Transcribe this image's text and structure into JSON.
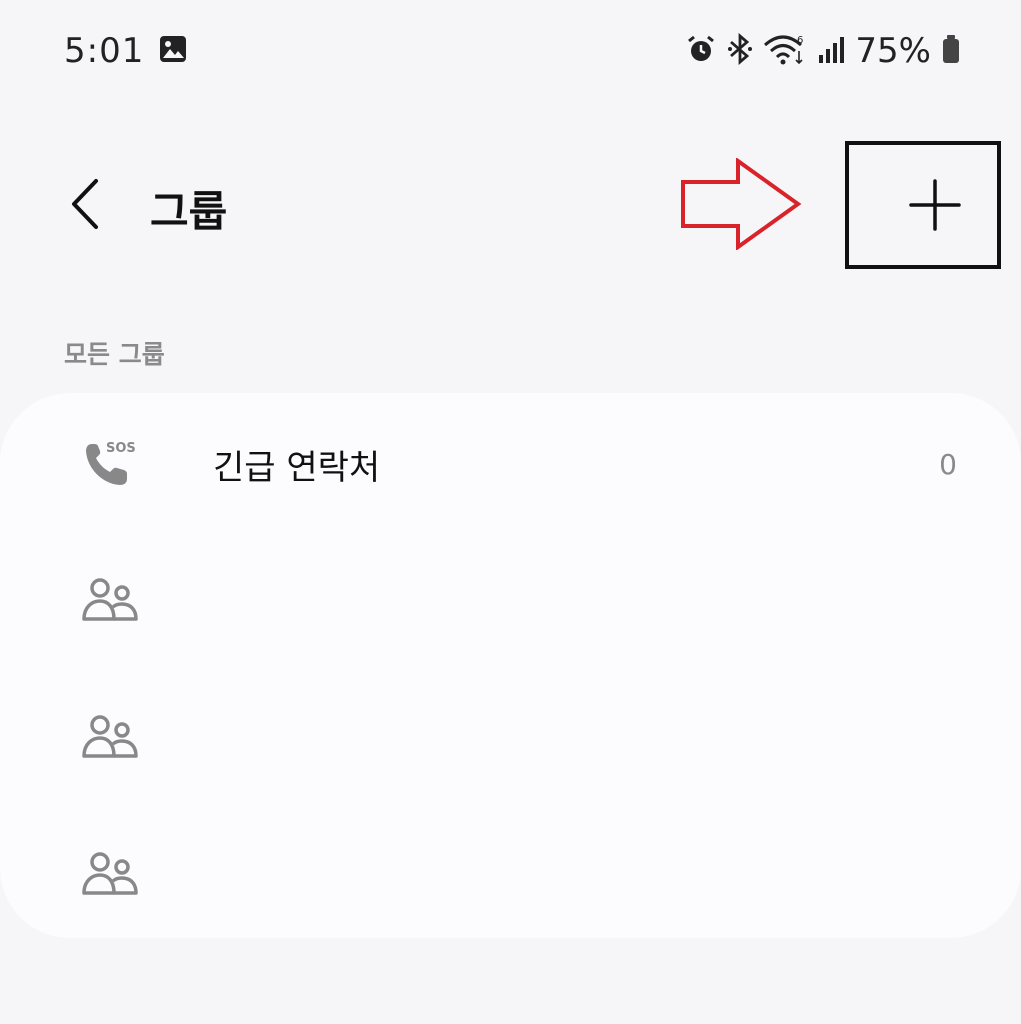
{
  "status_bar": {
    "time": "5:01",
    "battery": "75%",
    "icons": [
      "gallery-icon",
      "alarm-icon",
      "bluetooth-icon",
      "wifi-icon",
      "signal-icon",
      "battery-icon"
    ]
  },
  "header": {
    "title": "그룹",
    "back_icon": "chevron-left-icon",
    "add_icon": "plus-icon"
  },
  "annotation": {
    "arrow_color": "#d9232a",
    "highlight_color": "#111111"
  },
  "section": {
    "label": "모든 그룹"
  },
  "groups": [
    {
      "icon": "sos-phone-icon",
      "name": "긴급 연락처",
      "count": "0"
    },
    {
      "icon": "people-icon",
      "name": "",
      "count": ""
    },
    {
      "icon": "people-icon",
      "name": "",
      "count": ""
    },
    {
      "icon": "people-icon",
      "name": "",
      "count": ""
    }
  ]
}
